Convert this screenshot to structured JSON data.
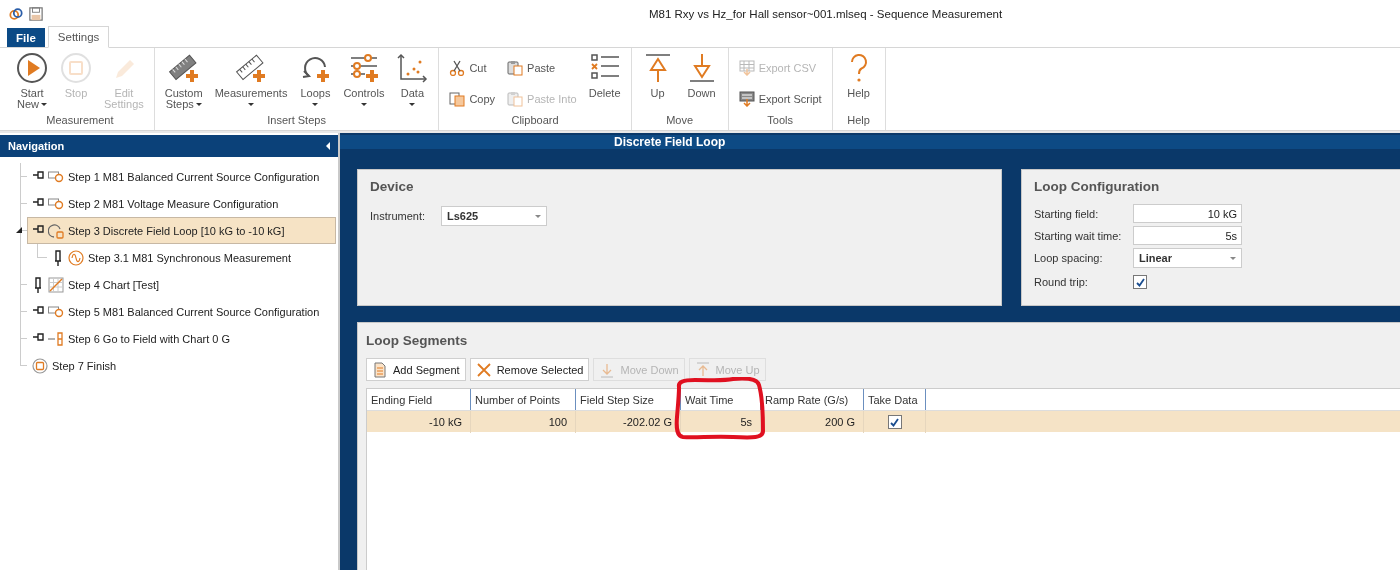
{
  "window": {
    "title": "M81 Rxy vs Hz_for Hall sensor~001.mlseq - Sequence Measurement"
  },
  "menu_tabs": [
    {
      "label": "File",
      "kind": "file",
      "selected": false
    },
    {
      "label": "Settings",
      "kind": "tab",
      "selected": true
    }
  ],
  "ribbon_groups": [
    {
      "label": "Measurement",
      "buttons": [
        {
          "lines": [
            "Start",
            "New"
          ],
          "kind": "large",
          "disabled": false,
          "dropdown": true
        },
        {
          "lines": [
            "Stop"
          ],
          "kind": "large",
          "disabled": true
        },
        {
          "lines": [
            "Edit",
            "Settings"
          ],
          "kind": "large",
          "disabled": true
        }
      ]
    },
    {
      "label": "Insert Steps",
      "buttons": [
        {
          "lines": [
            "Custom",
            "Steps"
          ],
          "kind": "large",
          "disabled": false,
          "dropdown": true
        },
        {
          "lines": [
            "Measurements"
          ],
          "kind": "large",
          "disabled": false,
          "dropdown": true
        },
        {
          "lines": [
            "Loops"
          ],
          "kind": "large",
          "disabled": false,
          "dropdown": true
        },
        {
          "lines": [
            "Controls"
          ],
          "kind": "large",
          "disabled": false,
          "dropdown": true
        },
        {
          "lines": [
            "Data"
          ],
          "kind": "large",
          "disabled": false,
          "dropdown": true
        }
      ]
    },
    {
      "label": "Clipboard",
      "buttons": [
        {
          "lines": [
            "Cut"
          ],
          "kind": "small",
          "disabled": false
        },
        {
          "lines": [
            "Copy"
          ],
          "kind": "small",
          "disabled": false
        },
        {
          "lines": [
            "Paste"
          ],
          "kind": "small",
          "disabled": false
        },
        {
          "lines": [
            "Paste Into"
          ],
          "kind": "small",
          "disabled": true
        },
        {
          "lines": [
            "Delete"
          ],
          "kind": "large",
          "disabled": false
        }
      ]
    },
    {
      "label": "Move",
      "buttons": [
        {
          "lines": [
            "Up"
          ],
          "kind": "large",
          "disabled": false
        },
        {
          "lines": [
            "Down"
          ],
          "kind": "large",
          "disabled": false
        }
      ]
    },
    {
      "label": "Tools",
      "buttons": [
        {
          "lines": [
            "Export CSV"
          ],
          "kind": "small",
          "disabled": true
        },
        {
          "lines": [
            "Export Script"
          ],
          "kind": "small",
          "disabled": false
        }
      ]
    },
    {
      "label": "Help",
      "buttons": [
        {
          "lines": [
            "Help"
          ],
          "kind": "large",
          "disabled": false
        }
      ]
    }
  ],
  "navigation": {
    "title": "Navigation",
    "steps": [
      {
        "label": "Step 1 M81 Balanced Current Source Configuration",
        "kind": "source",
        "pinned": false,
        "selected": false
      },
      {
        "label": "Step 2 M81 Voltage Measure Configuration",
        "kind": "source",
        "pinned": false,
        "selected": false
      },
      {
        "label": "Step 3 Discrete Field Loop [10 kG to -10 kG]",
        "kind": "loop",
        "pinned": false,
        "selected": true,
        "expanded": true,
        "children": [
          {
            "label": "Step 3.1 M81 Synchronous Measurement",
            "kind": "measurement",
            "pinned": true,
            "selected": false
          }
        ]
      },
      {
        "label": "Step 4 Chart [Test]",
        "kind": "chart",
        "pinned": true,
        "selected": false
      },
      {
        "label": "Step 5 M81 Balanced Current Source Configuration",
        "kind": "source",
        "pinned": false,
        "selected": false
      },
      {
        "label": "Step 6 Go to Field with Chart 0 G",
        "kind": "goto",
        "pinned": false,
        "selected": false
      },
      {
        "label": "Step 7 Finish",
        "kind": "finish",
        "selected": false
      }
    ]
  },
  "detail": {
    "title": "Discrete Field Loop",
    "device": {
      "title": "Device",
      "fields": [
        {
          "label": "Instrument:",
          "value": "Ls625",
          "kind": "dropdown"
        }
      ]
    },
    "loop_configuration": {
      "title": "Loop Configuration",
      "fields": [
        {
          "label": "Starting field:",
          "value": "10 kG",
          "kind": "text"
        },
        {
          "label": "Starting wait time:",
          "value": "5s",
          "kind": "text"
        },
        {
          "label": "Loop spacing:",
          "value": "Linear",
          "kind": "dropdown"
        },
        {
          "label": "Round trip:",
          "kind": "checkbox",
          "checked": true
        }
      ]
    },
    "loop_segments": {
      "title": "Loop Segments",
      "toolbar": [
        {
          "label": "Add Segment",
          "disabled": false
        },
        {
          "label": "Remove Selected",
          "disabled": false
        },
        {
          "label": "Move Down",
          "disabled": true
        },
        {
          "label": "Move Up",
          "disabled": true
        }
      ],
      "columns": [
        "Ending Field",
        "Number of Points",
        "Field Step Size",
        "Wait Time",
        "Ramp Rate (G/s)",
        "Take Data"
      ],
      "rows": [
        {
          "selected": true,
          "cells": [
            "-10 kG",
            "100",
            "-202.02 G",
            "5s",
            "200 G"
          ],
          "take_data": true
        }
      ]
    }
  }
}
